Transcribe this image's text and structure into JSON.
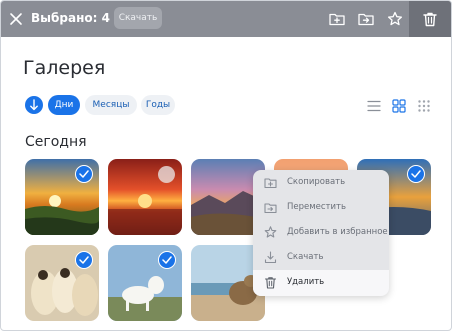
{
  "topbar": {
    "selected_label": "Выбрано: 4",
    "download_label": "Скачать"
  },
  "title": "Галерея",
  "filters": {
    "days": "Дни",
    "months": "Месяцы",
    "years": "Годы",
    "active": "days"
  },
  "section_title": "Сегодня",
  "photos": [
    {
      "scene": "sunset-meadow",
      "selected": true
    },
    {
      "scene": "red-sunset",
      "selected": false
    },
    {
      "scene": "mountain-dusk",
      "selected": false
    },
    {
      "scene": "orange-sky",
      "selected": false
    },
    {
      "scene": "blue-sky",
      "selected": true
    },
    {
      "scene": "three-dogs",
      "selected": true
    },
    {
      "scene": "white-dog",
      "selected": true
    },
    {
      "scene": "dog-beach",
      "selected": false
    }
  ],
  "context_menu": {
    "items": [
      {
        "label": "Скопировать",
        "icon": "copy-icon"
      },
      {
        "label": "Переместить",
        "icon": "move-icon"
      },
      {
        "label": "Добавить в избранное",
        "icon": "star-icon"
      },
      {
        "label": "Скачать",
        "icon": "download-icon"
      },
      {
        "label": "Удалить",
        "icon": "trash-icon"
      }
    ],
    "highlighted": 4
  },
  "colors": {
    "accent": "#1a73e8",
    "topbar": "#8a8d95"
  }
}
